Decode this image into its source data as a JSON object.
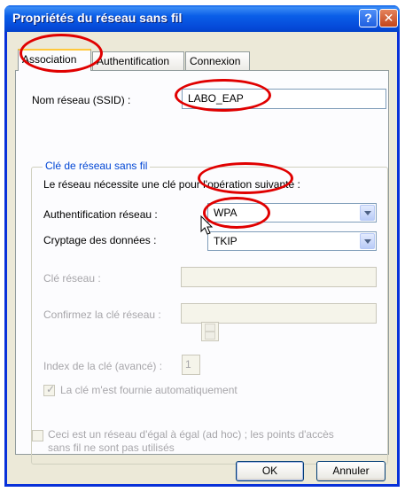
{
  "window": {
    "title": "Propriétés du réseau sans fil",
    "help_icon": "?",
    "close_icon": "✕"
  },
  "tabs": [
    {
      "label": "Association",
      "active": true
    },
    {
      "label": "Authentification",
      "active": false
    },
    {
      "label": "Connexion",
      "active": false
    }
  ],
  "ssid": {
    "label": "Nom réseau (SSID) :",
    "value": "LABO_EAP"
  },
  "key_group": {
    "title": "Clé de réseau sans fil",
    "requirement_text": "Le réseau nécessite une clé pour l'opération suivante :",
    "auth": {
      "label": "Authentification réseau :",
      "value": "WPA"
    },
    "encryption": {
      "label": "Cryptage des données :",
      "value": "TKIP"
    },
    "network_key": {
      "label": "Clé réseau :",
      "value": ""
    },
    "confirm_key": {
      "label": "Confirmez la clé réseau :",
      "value": ""
    },
    "key_index": {
      "label": "Index de la clé (avancé) :",
      "value": "1"
    },
    "auto_key": {
      "label": "La clé m'est fournie automatiquement",
      "checked": true
    }
  },
  "adhoc": {
    "label_line1": "Ceci est un réseau d'égal à égal (ad hoc) ; les points d'accès",
    "label_line2": "sans fil ne sont pas utilisés",
    "checked": false
  },
  "buttons": {
    "ok": "OK",
    "cancel": "Annuler"
  },
  "colors": {
    "titlebar": "#0a5ee8",
    "annotation": "#e00000",
    "group_title": "#0046d5"
  }
}
